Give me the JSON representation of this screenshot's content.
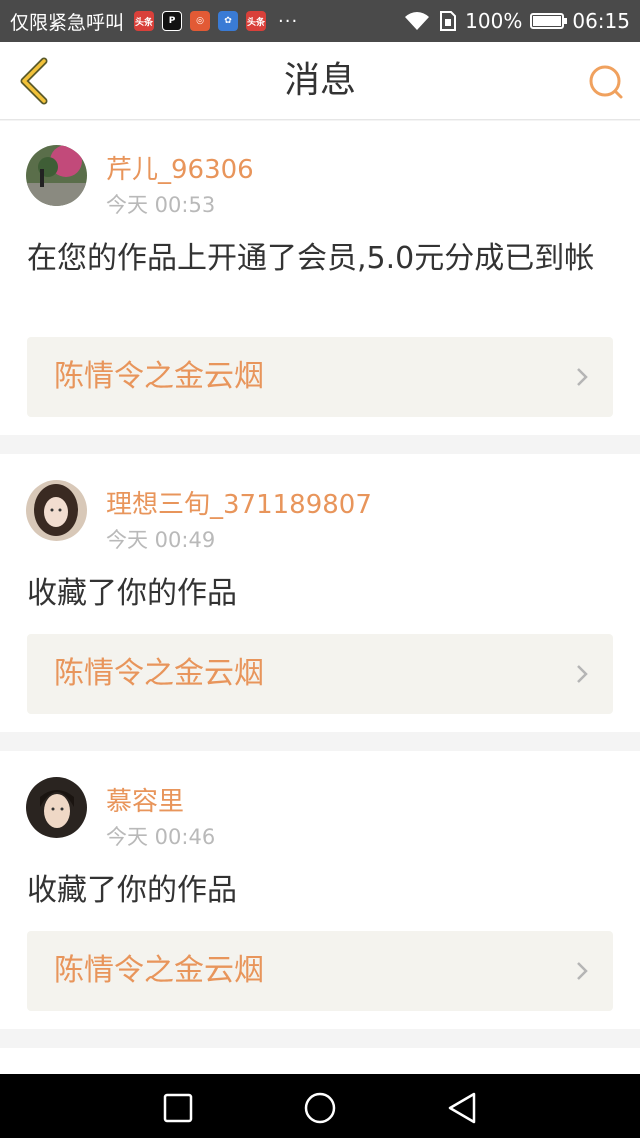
{
  "status_bar": {
    "carrier": "仅限紧急呼叫",
    "more": "···",
    "battery_percent": "100%",
    "battery_level": 1.0,
    "time": "06:15",
    "app_icons": [
      "toutiao-icon",
      "app-icon",
      "weibo-icon",
      "baidu-icon",
      "toutiao-icon"
    ]
  },
  "header": {
    "title": "消息"
  },
  "colors": {
    "accent": "#e8955b",
    "text": "#333333",
    "muted": "#b9b9b9",
    "card_bg": "#f4f3ee"
  },
  "messages": [
    {
      "username": "芹儿_96306",
      "time": "今天 00:53",
      "text": "在您的作品上开通了会员,5.0元分成已到帐",
      "work_title": "陈情令之金云烟"
    },
    {
      "username": "理想三旬_371189807",
      "time": "今天 00:49",
      "text": "收藏了你的作品",
      "work_title": "陈情令之金云烟"
    },
    {
      "username": "慕容里",
      "time": "今天 00:46",
      "text": "收藏了你的作品",
      "work_title": "陈情令之金云烟"
    }
  ]
}
